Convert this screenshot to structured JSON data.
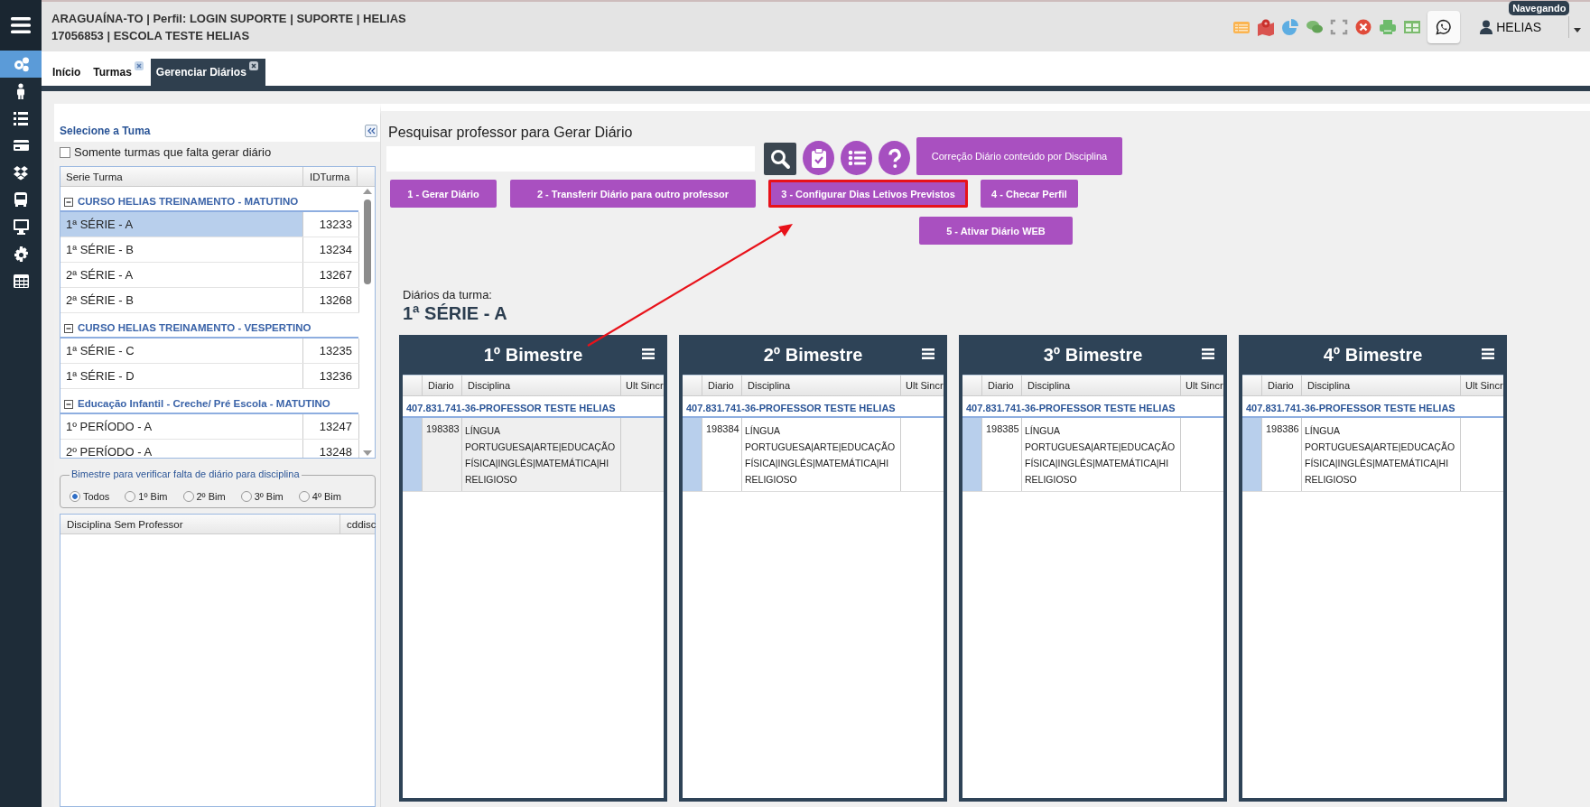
{
  "header": {
    "line1": "ARAGUAÍNA-TO | Perfil: LOGIN SUPORTE | SUPORTE | HELIAS",
    "line2": "17056853 | ESCOLA TESTE HELIAS",
    "user": "HELIAS",
    "tooltip": "Navegando"
  },
  "sidebar": {
    "items": [
      {
        "kind": "gears",
        "selected": true
      },
      {
        "kind": "person",
        "selected": false
      },
      {
        "kind": "list",
        "selected": false
      },
      {
        "kind": "card",
        "selected": false
      },
      {
        "kind": "boxes",
        "selected": false
      },
      {
        "kind": "bus",
        "selected": false
      },
      {
        "kind": "monitor",
        "selected": false
      },
      {
        "kind": "gear",
        "selected": false
      },
      {
        "kind": "table",
        "selected": false
      }
    ]
  },
  "tabs": [
    {
      "label": "Início",
      "closable": false,
      "selected": false
    },
    {
      "label": "Turmas",
      "closable": true,
      "selected": false
    },
    {
      "label": "Gerenciar Diários",
      "closable": true,
      "selected": true
    }
  ],
  "left_panel": {
    "title": "Selecione a Tuma",
    "filter": {
      "label": "Somente turmas que falta gerar diário",
      "checked": false
    },
    "grid": {
      "columns": [
        "Serie Turma",
        "IDTurma"
      ],
      "groups": [
        {
          "title": "CURSO HELIAS TREINAMENTO - MATUTINO",
          "expanded": true,
          "rows": [
            {
              "serie": "1ª SÉRIE - A",
              "id": "13233",
              "selected": true
            },
            {
              "serie": "1ª SÉRIE - B",
              "id": "13234",
              "selected": false
            },
            {
              "serie": "2ª SÉRIE - A",
              "id": "13267",
              "selected": false
            },
            {
              "serie": "2ª SÉRIE - B",
              "id": "13268",
              "selected": false
            }
          ]
        },
        {
          "title": "CURSO HELIAS TREINAMENTO - VESPERTINO",
          "expanded": true,
          "rows": [
            {
              "serie": "1ª SÉRIE - C",
              "id": "13235",
              "selected": false
            },
            {
              "serie": "1ª SÉRIE - D",
              "id": "13236",
              "selected": false
            }
          ]
        },
        {
          "title": "Educação Infantil - Creche/ Pré Escola - MATUTINO",
          "expanded": true,
          "rows": [
            {
              "serie": "1º PERÍODO - A",
              "id": "13247",
              "selected": false
            },
            {
              "serie": "2º PERÍODO - A",
              "id": "13248",
              "selected": false
            }
          ]
        }
      ]
    },
    "bimestre_filter": {
      "legend": "Bimestre para verificar falta de diário para disciplina",
      "options": [
        {
          "label": "Todos",
          "selected": true
        },
        {
          "label": "1º Bim",
          "selected": false
        },
        {
          "label": "2º Bim",
          "selected": false
        },
        {
          "label": "3º Bim",
          "selected": false
        },
        {
          "label": "4º Bim",
          "selected": false
        }
      ]
    },
    "discipline_grid": {
      "columns": [
        "Disciplina Sem Professor",
        "cddisc"
      ]
    }
  },
  "search": {
    "label": "Pesquisar professor para Gerar Diário",
    "correction_button": "Correção Diário conteúdo por Disciplina"
  },
  "action_buttons": [
    {
      "label": "1 - Gerar Diário",
      "highlighted": false
    },
    {
      "label": "2 - Transferir Diário para outro professor",
      "highlighted": false
    },
    {
      "label": "3 - Configurar Dias Letivos Previstos",
      "highlighted": true
    },
    {
      "label": "4 - Checar Perfil",
      "highlighted": false
    },
    {
      "label": "5 - Ativar Diário WEB",
      "highlighted": false
    }
  ],
  "diaries": {
    "label": "Diários da turma:",
    "class_name": "1ª SÉRIE - A",
    "cards": [
      {
        "title": "1º Bimestre",
        "columns": [
          "Diario",
          "Disciplina",
          "Ult Sincr"
        ],
        "group": "407.831.741-36-PROFESSOR TESTE HELIAS",
        "rows": [
          {
            "diario": "198383",
            "disciplina": "LÍNGUA\nPORTUGUESA|ARTE|EDUCAÇÃO\nFÍSICA|INGLÊS|MATEMÁTICA|HI\nRELIGIOSO",
            "selected": true
          }
        ]
      },
      {
        "title": "2º Bimestre",
        "columns": [
          "Diario",
          "Disciplina",
          "Ult Sincr"
        ],
        "group": "407.831.741-36-PROFESSOR TESTE HELIAS",
        "rows": [
          {
            "diario": "198384",
            "disciplina": "LÍNGUA\nPORTUGUESA|ARTE|EDUCAÇÃO\nFÍSICA|INGLÊS|MATEMÁTICA|HI\nRELIGIOSO",
            "selected": false
          }
        ]
      },
      {
        "title": "3º Bimestre",
        "columns": [
          "Diario",
          "Disciplina",
          "Ult Sincr"
        ],
        "group": "407.831.741-36-PROFESSOR TESTE HELIAS",
        "rows": [
          {
            "diario": "198385",
            "disciplina": "LÍNGUA\nPORTUGUESA|ARTE|EDUCAÇÃO\nFÍSICA|INGLÊS|MATEMÁTICA|HI\nRELIGIOSO",
            "selected": false
          }
        ]
      },
      {
        "title": "4º Bimestre",
        "columns": [
          "Diario",
          "Disciplina",
          "Ult Sincr"
        ],
        "group": "407.831.741-36-PROFESSOR TESTE HELIAS",
        "rows": [
          {
            "diario": "198386",
            "disciplina": "LÍNGUA\nPORTUGUESA|ARTE|EDUCAÇÃO\nFÍSICA|INGLÊS|MATEMÁTICA|HI\nRELIGIOSO",
            "selected": false
          }
        ]
      }
    ]
  }
}
